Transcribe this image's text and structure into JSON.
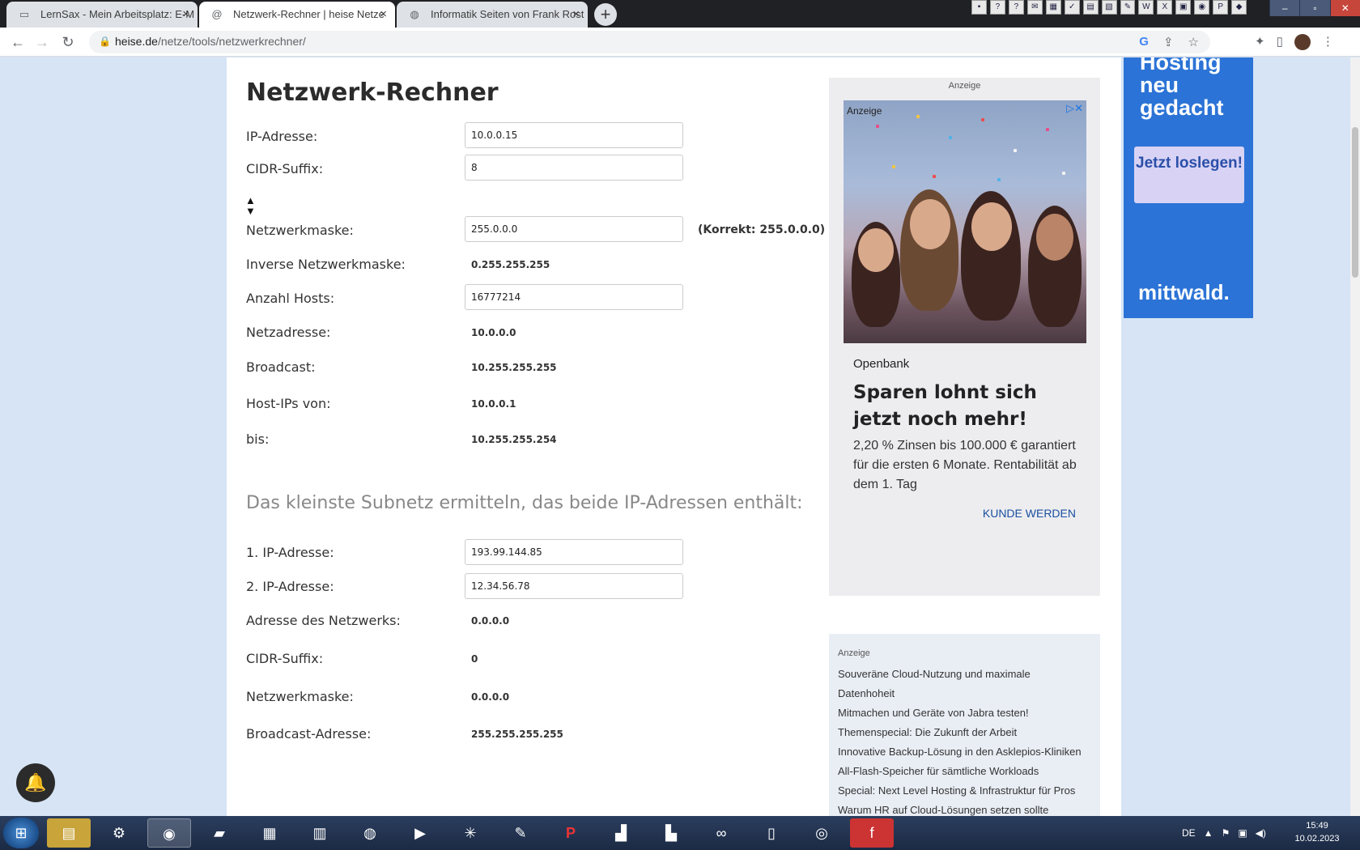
{
  "browser": {
    "tabs": [
      {
        "title": "LernSax - Mein Arbeitsplatz: E-M",
        "active": false
      },
      {
        "title": "Netzwerk-Rechner | heise Netze",
        "active": true
      },
      {
        "title": "Informatik Seiten von Frank Rost",
        "active": false
      }
    ],
    "url_domain": "heise.de",
    "url_path": "/netze/tools/netzwerkrechner/"
  },
  "calc": {
    "title": "Netzwerk-Rechner",
    "ip_label": "IP-Adresse:",
    "ip_value": "10.0.0.15",
    "cidr_label": "CIDR-Suffix:",
    "cidr_value": "8",
    "mask_label": "Netzwerkmaske:",
    "mask_value": "255.0.0.0",
    "mask_correct": "(Korrekt: 255.0.0.0)",
    "inv_label": "Inverse Netzwerkmaske:",
    "inv_value": "0.255.255.255",
    "hosts_label": "Anzahl Hosts:",
    "hosts_value": "16777214",
    "net_label": "Netzadresse:",
    "net_value": "10.0.0.0",
    "bc_label": "Broadcast:",
    "bc_value": "10.255.255.255",
    "from_label": "Host-IPs von:",
    "from_value": "10.0.0.1",
    "to_label": "bis:",
    "to_value": "10.255.255.254"
  },
  "subnet": {
    "heading": "Das kleinste Subnetz ermitteln, das beide IP-Adressen enthält:",
    "ip1_label": "1. IP-Adresse:",
    "ip1_value": "193.99.144.85",
    "ip2_label": "2. IP-Adresse:",
    "ip2_value": "12.34.56.78",
    "net_label": "Adresse des Netzwerks:",
    "net_value": "0.0.0.0",
    "cidr_label": "CIDR-Suffix:",
    "cidr_value": "0",
    "mask_label": "Netzwerkmaske:",
    "mask_value": "0.0.0.0",
    "bc_label": "Broadcast-Adresse:",
    "bc_value": "255.255.255.255"
  },
  "ad_main": {
    "label": "Anzeige",
    "image_label": "Anzeige",
    "brand": "Openbank",
    "headline": "Sparen lohnt sich jetzt noch mehr!",
    "body": "2,20 % Zinsen bis 100.000 € garantiert für die ersten 6 Monate. Rentabilität ab dem 1. Tag",
    "cta": "KUNDE WERDEN"
  },
  "ad_links": {
    "label": "Anzeige",
    "items": [
      "Souveräne Cloud-Nutzung und maximale",
      "Datenhoheit",
      "Mitmachen und Geräte von Jabra testen!",
      "Themenspecial: Die Zukunft der Arbeit",
      "Innovative Backup-Lösung in den Asklepios-Kliniken",
      "All-Flash-Speicher für sämtliche Workloads",
      "Special: Next Level Hosting & Infrastruktur für Pros",
      "Warum HR auf Cloud-Lösungen setzen sollte"
    ]
  },
  "ad_side": {
    "headline": "Hosting neu gedacht",
    "button": "Jetzt loslegen!",
    "logo": "mittwald."
  },
  "taskbar": {
    "lang": "DE",
    "time": "15:49",
    "date": "10.02.2023"
  }
}
